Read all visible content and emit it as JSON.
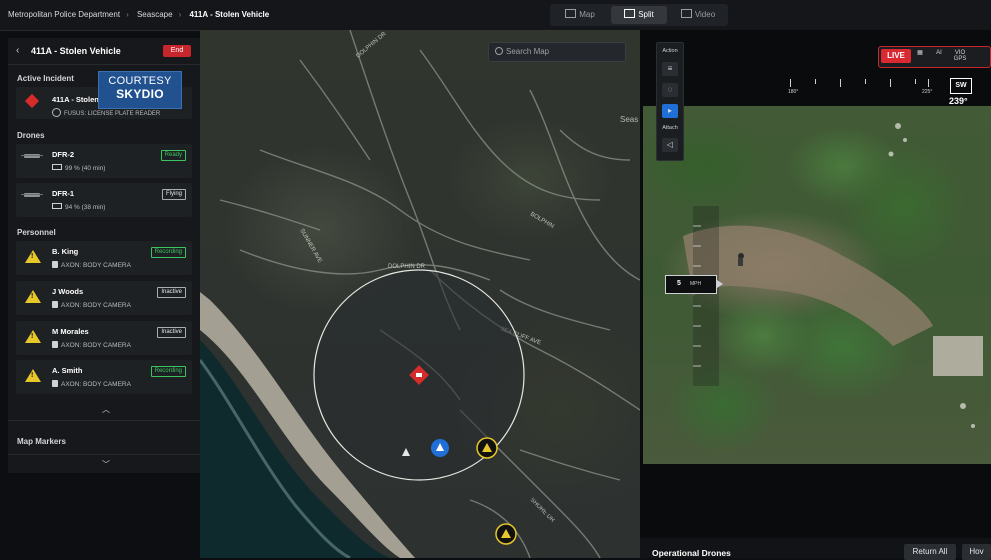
{
  "breadcrumb": [
    "Metropolitan Police Department",
    "Seascape",
    "411A - Stolen Vehicle"
  ],
  "view_modes": [
    {
      "label": "Map",
      "active": false
    },
    {
      "label": "Split",
      "active": true
    },
    {
      "label": "Video",
      "active": false
    }
  ],
  "incident_panel": {
    "title": "411A - Stolen Vehicle",
    "end_label": "End",
    "active_incident_heading": "Active Incident",
    "active_incident": {
      "name": "411A - Stolen Vehicle",
      "source": "FUSUS: LICENSE PLATE READER"
    },
    "drones_heading": "Drones",
    "drones": [
      {
        "name": "DFR-2",
        "battery": "99 % (40 min)",
        "status": "Ready"
      },
      {
        "name": "DFR-1",
        "battery": "94 % (38 min)",
        "status": "Flying"
      }
    ],
    "personnel_heading": "Personnel",
    "personnel": [
      {
        "name": "B. King",
        "device": "AXON: BODY CAMERA",
        "status": "Recording"
      },
      {
        "name": "J Woods",
        "device": "AXON: BODY CAMERA",
        "status": "Inactive"
      },
      {
        "name": "M Morales",
        "device": "AXON: BODY CAMERA",
        "status": "Inactive"
      },
      {
        "name": "A. Smith",
        "device": "AXON: BODY CAMERA",
        "status": "Recording"
      }
    ],
    "map_markers_heading": "Map Markers"
  },
  "courtesy": {
    "line1": "COURTESY",
    "line2": "SKYDIO"
  },
  "map": {
    "search_placeholder": "Search Map",
    "place_label": "Seas",
    "street_labels": [
      "DOLPHIN DR",
      "SUNNER AVE",
      "DOLPHIN DR",
      "DOLPHIN DR",
      "BOLPHIN",
      "SEA CLIFF AVE",
      "SHORE DR"
    ]
  },
  "video": {
    "live_label": "LIVE",
    "indicators": [
      "AI",
      "VIO",
      "GPS"
    ],
    "heading_dir": "SW",
    "heading_deg": "239°",
    "compass_ticks": [
      "180°",
      "225°"
    ],
    "speed_value": "5",
    "speed_unit": "MPH"
  },
  "action_panel": {
    "action_label": "Action",
    "attach_label": "Attach"
  },
  "operational": {
    "title": "Operational Drones",
    "return_all": "Return All",
    "hover": "Hov"
  },
  "colors": {
    "accent_red": "#d92a32",
    "ready_green": "#3ec45f",
    "marker_yellow": "#e8c72a",
    "drone_blue": "#1f6fd6"
  }
}
